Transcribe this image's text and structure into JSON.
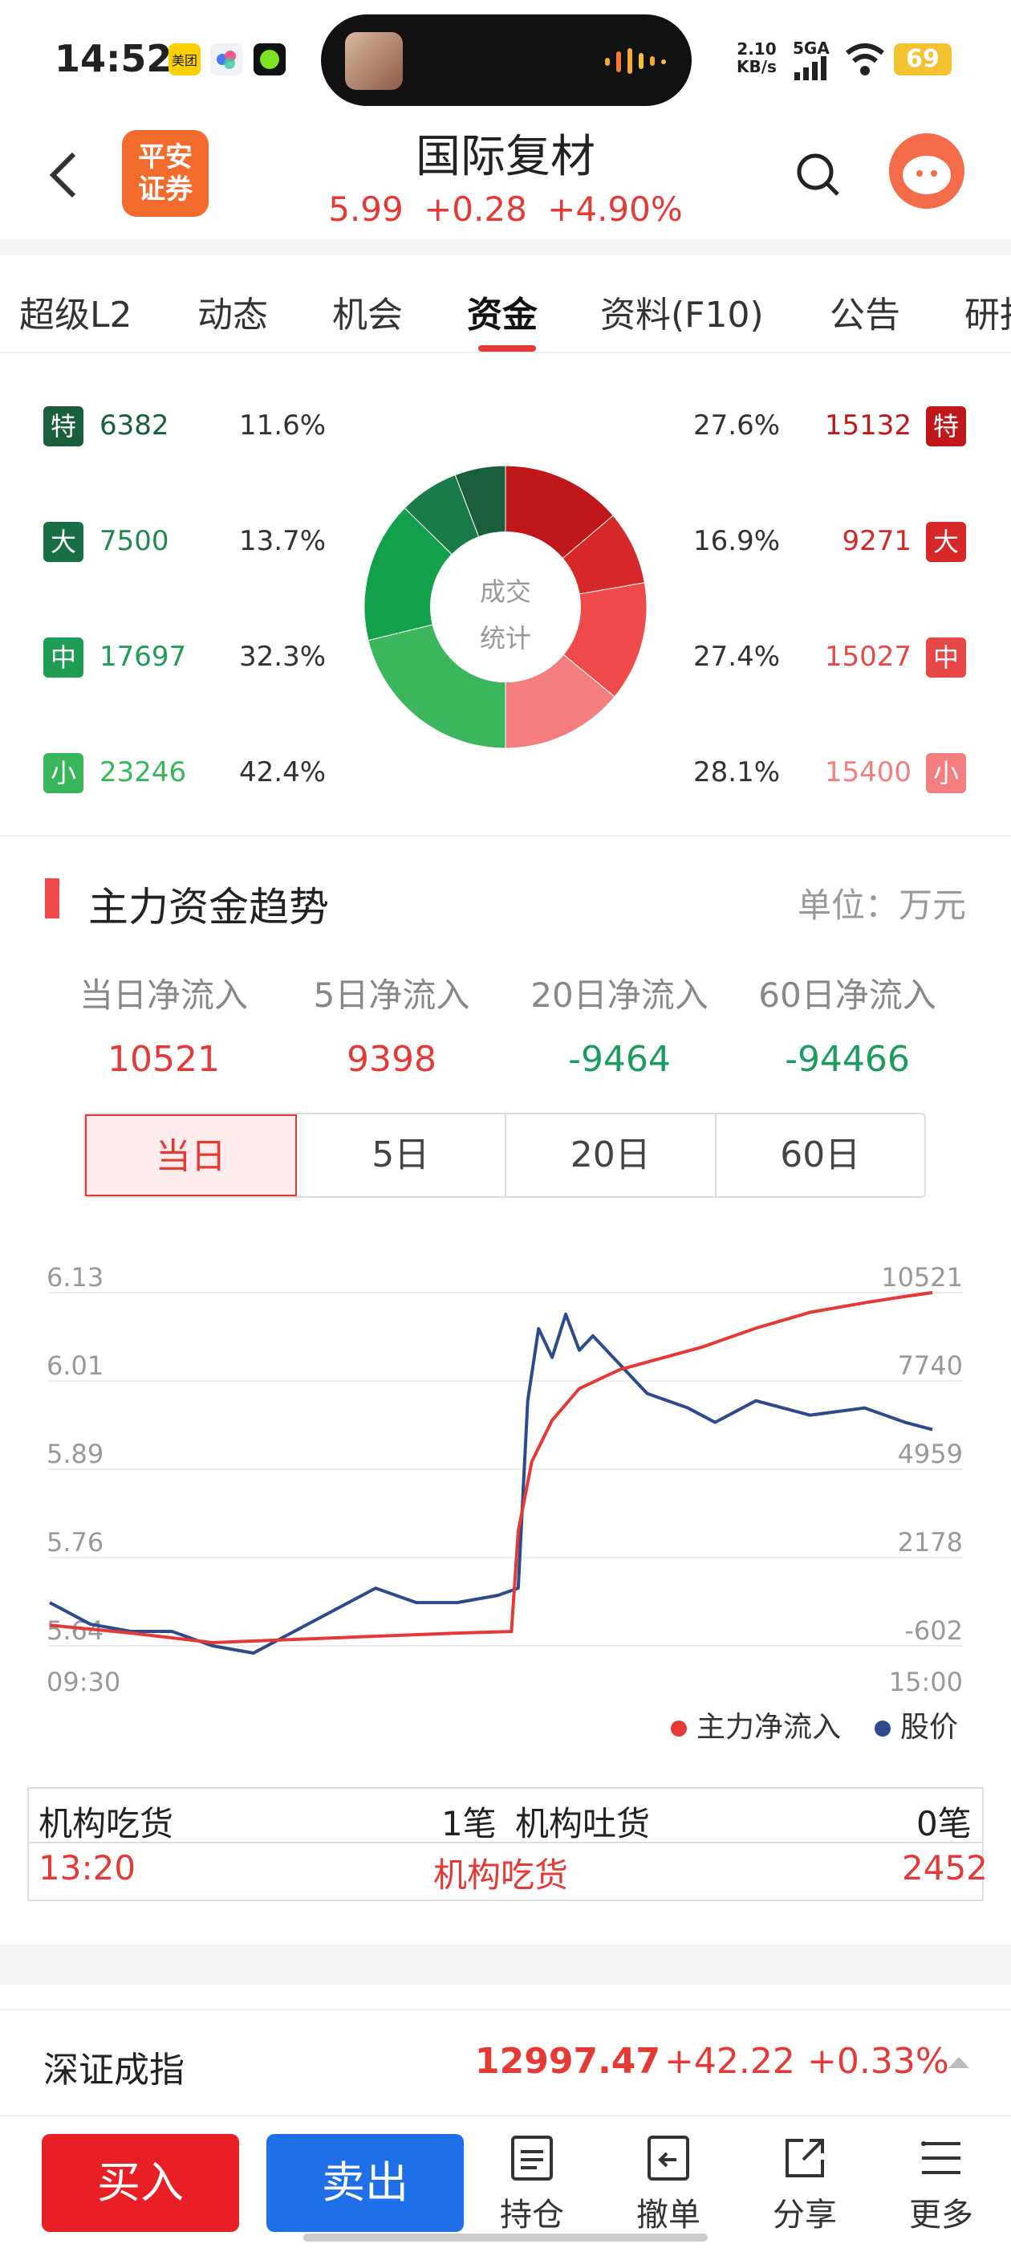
{
  "status_bar": {
    "time": "14:52",
    "apps": [
      "美团",
      "",
      ""
    ],
    "net_speed_top": "2.10",
    "net_speed_unit": "KB/s",
    "signal": "5GA",
    "battery": "69"
  },
  "header": {
    "broker_logo": "平安\n证券",
    "stock_name": "国际复材",
    "price": "5.99",
    "change": "+0.28",
    "change_pct": "+4.90%"
  },
  "tabs": [
    "超级L2",
    "动态",
    "机会",
    "资金",
    "资料(F10)",
    "公告",
    "研报"
  ],
  "active_tab": "资金",
  "distribution": {
    "center_label_1": "成交",
    "center_label_2": "统计",
    "rows": [
      {
        "badge": "特",
        "out_val": "6382",
        "out_pct": "11.6%",
        "in_pct": "27.6%",
        "in_val": "15132"
      },
      {
        "badge": "大",
        "out_val": "7500",
        "out_pct": "13.7%",
        "in_pct": "16.9%",
        "in_val": "9271"
      },
      {
        "badge": "中",
        "out_val": "17697",
        "out_pct": "32.3%",
        "in_pct": "27.4%",
        "in_val": "15027"
      },
      {
        "badge": "小",
        "out_val": "23246",
        "out_pct": "42.4%",
        "in_pct": "28.1%",
        "in_val": "15400"
      }
    ]
  },
  "section": {
    "title": "主力资金趋势",
    "unit": "单位：万元"
  },
  "net_flow": {
    "labels": [
      "当日净流入",
      "5日净流入",
      "20日净流入",
      "60日净流入"
    ],
    "values": [
      "10521",
      "9398",
      "-9464",
      "-94466"
    ]
  },
  "segments": [
    "当日",
    "5日",
    "20日",
    "60日"
  ],
  "active_segment": "当日",
  "chart_data": {
    "type": "line",
    "left_axis_ticks": [
      "6.13",
      "6.01",
      "5.89",
      "5.76",
      "5.64"
    ],
    "right_axis_ticks": [
      "10521",
      "7740",
      "4959",
      "2178",
      "-602"
    ],
    "x_ticks": [
      "09:30",
      "15:00"
    ],
    "series": [
      {
        "name": "主力净流入",
        "color": "#e53935",
        "points": [
          [
            0,
            50
          ],
          [
            60,
            -200
          ],
          [
            120,
            -500
          ],
          [
            180,
            -400
          ],
          [
            240,
            -300
          ],
          [
            300,
            -200
          ],
          [
            340,
            -150
          ],
          [
            345,
            3000
          ],
          [
            355,
            5200
          ],
          [
            370,
            6500
          ],
          [
            390,
            7500
          ],
          [
            420,
            8100
          ],
          [
            480,
            8800
          ],
          [
            520,
            9400
          ],
          [
            560,
            9900
          ],
          [
            600,
            10200
          ],
          [
            630,
            10400
          ],
          [
            650,
            10521
          ]
        ]
      },
      {
        "name": "股价",
        "color": "#2c4a8c",
        "points": [
          [
            0,
            5.7
          ],
          [
            30,
            5.67
          ],
          [
            60,
            5.66
          ],
          [
            90,
            5.66
          ],
          [
            120,
            5.64
          ],
          [
            150,
            5.63
          ],
          [
            180,
            5.66
          ],
          [
            210,
            5.69
          ],
          [
            240,
            5.72
          ],
          [
            270,
            5.7
          ],
          [
            300,
            5.7
          ],
          [
            330,
            5.71
          ],
          [
            345,
            5.72
          ],
          [
            352,
            5.98
          ],
          [
            360,
            6.08
          ],
          [
            370,
            6.04
          ],
          [
            380,
            6.1
          ],
          [
            390,
            6.05
          ],
          [
            400,
            6.07
          ],
          [
            420,
            6.03
          ],
          [
            440,
            5.99
          ],
          [
            470,
            5.97
          ],
          [
            490,
            5.95
          ],
          [
            520,
            5.98
          ],
          [
            560,
            5.96
          ],
          [
            600,
            5.97
          ],
          [
            630,
            5.95
          ],
          [
            650,
            5.94
          ]
        ]
      }
    ]
  },
  "legend": [
    "主力净流入",
    "股价"
  ],
  "institution": {
    "buy_label": "机构吃货",
    "buy_count": "1笔",
    "sell_label": "机构吐货",
    "sell_count": "0笔",
    "row_time": "13:20",
    "row_type": "机构吃货",
    "row_value": "2452"
  },
  "index": {
    "name": "深证成指",
    "value": "12997.47",
    "change": "+42.22",
    "pct": "+0.33%"
  },
  "bottom": {
    "buy": "买入",
    "sell": "卖出",
    "tools": [
      "持仓",
      "撤单",
      "分享",
      "更多"
    ]
  }
}
